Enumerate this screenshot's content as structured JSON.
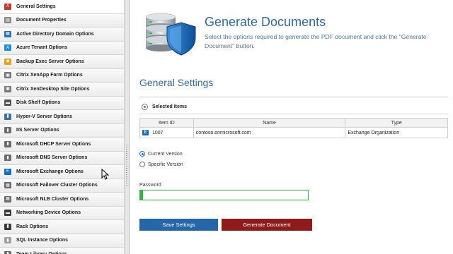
{
  "sidebar": {
    "items": [
      {
        "label": "General Settings",
        "icon": "pdf-icon",
        "color": "#c0392b",
        "glyph": "A",
        "active": true
      },
      {
        "label": "Document Properties",
        "icon": "document-icon",
        "color": "#8a8a8a",
        "glyph": "▤"
      },
      {
        "label": "Active Directory Domain Options",
        "icon": "active-directory-icon",
        "color": "#2a6fb0",
        "glyph": "▦"
      },
      {
        "label": "Azure Tenant Options",
        "icon": "azure-icon",
        "color": "#1b8fd6",
        "glyph": "A"
      },
      {
        "label": "Backup Exec Server Options",
        "icon": "backup-exec-icon",
        "color": "#e5a21a",
        "glyph": "◆"
      },
      {
        "label": "Citrix XenApp Farm Options",
        "icon": "citrix-xenapp-icon",
        "color": "#7a7a7a",
        "glyph": "▣"
      },
      {
        "label": "Citrix XenDesktop Site Options",
        "icon": "citrix-xendesktop-icon",
        "color": "#7a7a7a",
        "glyph": "▣"
      },
      {
        "label": "Disk Shelf Options",
        "icon": "disk-shelf-icon",
        "color": "#555555",
        "glyph": "▬"
      },
      {
        "label": "Hyper-V Server Options",
        "icon": "hyper-v-icon",
        "color": "#3c6e9e",
        "glyph": "▮"
      },
      {
        "label": "IIS Server Options",
        "icon": "iis-server-icon",
        "color": "#6b6b6b",
        "glyph": "▮"
      },
      {
        "label": "Microsoft DHCP Server Options",
        "icon": "dhcp-server-icon",
        "color": "#6b6b6b",
        "glyph": "▮"
      },
      {
        "label": "Microsoft DNS Server Options",
        "icon": "dns-server-icon",
        "color": "#6b6b6b",
        "glyph": "▮"
      },
      {
        "label": "Microsoft Exchange Options",
        "icon": "exchange-icon",
        "color": "#0f6fc6",
        "glyph": "E"
      },
      {
        "label": "Microsoft Failover Cluster Options",
        "icon": "failover-cluster-icon",
        "color": "#6b6b6b",
        "glyph": "▦"
      },
      {
        "label": "Microsoft NLB Cluster Options",
        "icon": "nlb-cluster-icon",
        "color": "#6b6b6b",
        "glyph": "▦"
      },
      {
        "label": "Networking Device Options",
        "icon": "network-device-icon",
        "color": "#3a3a3a",
        "glyph": "▬"
      },
      {
        "label": "Rack Options",
        "icon": "rack-icon",
        "color": "#3a3a3a",
        "glyph": "▮"
      },
      {
        "label": "SQL Instance Options",
        "icon": "sql-instance-icon",
        "color": "#a0a0a0",
        "glyph": "▮"
      },
      {
        "label": "Team Library Options",
        "icon": "team-library-icon",
        "color": "#6b6b6b",
        "glyph": "▮"
      }
    ]
  },
  "header": {
    "title": "Generate Documents",
    "description": "Select the options required to generate the PDF document and click the \"Generate Document\" button."
  },
  "general_settings": {
    "title": "General Settings",
    "selected_items_label": "Selected Items",
    "table": {
      "columns": [
        "Item ID",
        "Name",
        "Type"
      ],
      "rows": [
        {
          "item_id": "1007",
          "name": "contoso.onmicrosoft.com",
          "type": "Exchange Organization"
        }
      ]
    },
    "version_options": {
      "current": "Current Version",
      "specific": "Specific Version",
      "selected": "current"
    },
    "password_label": "Password",
    "password_value": ""
  },
  "buttons": {
    "save": "Save Settings",
    "generate": "Generate Document"
  },
  "colors": {
    "accent_title": "#34699a",
    "save_button": "#2466a8",
    "generate_button": "#8e1a1a",
    "password_border": "#39b24a"
  }
}
